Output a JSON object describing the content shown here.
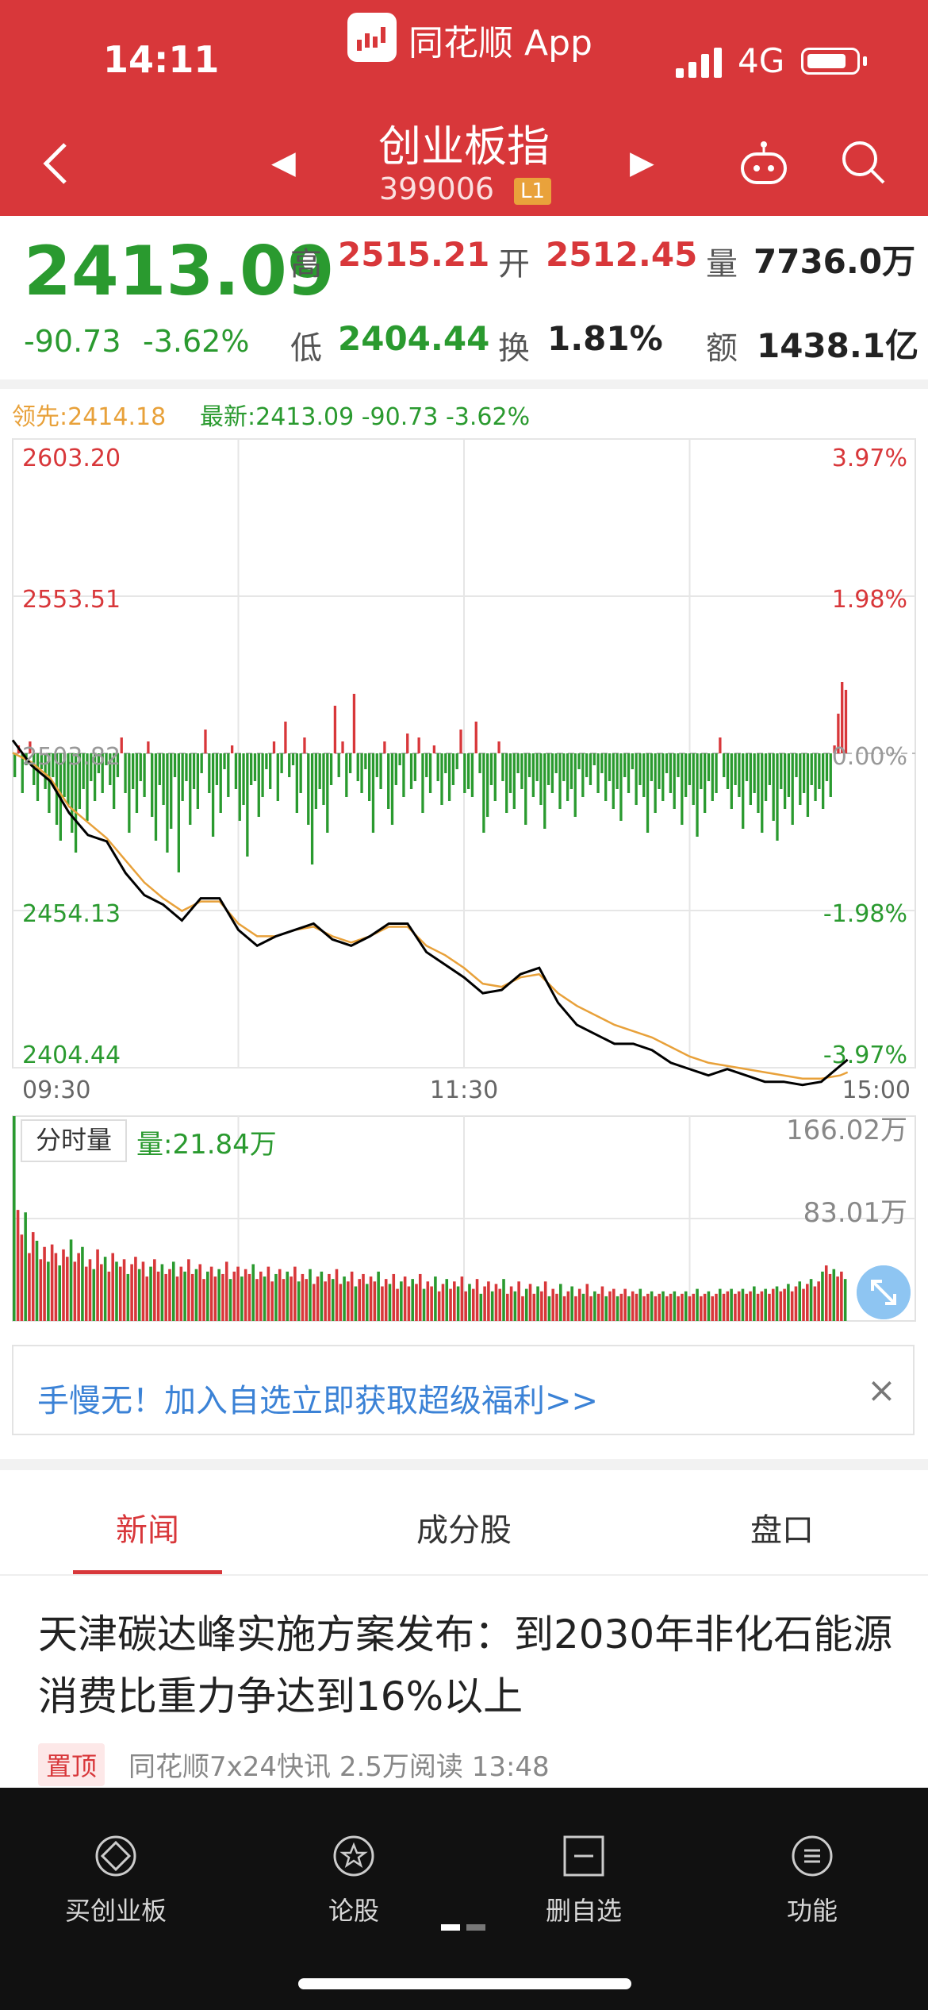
{
  "status_bar": {
    "time": "14:11",
    "app": "同花顺 App",
    "network": "4G"
  },
  "header": {
    "name": "创业板指",
    "code": "399006",
    "level": "L1"
  },
  "quote": {
    "last": "2413.09",
    "change": "-90.73",
    "change_pct": "-3.62%",
    "high_label": "高",
    "high": "2515.21",
    "open_label": "开",
    "open": "2512.45",
    "vol_label": "量",
    "volume": "7736.0万",
    "low_label": "低",
    "low": "2404.44",
    "turnover_label": "换",
    "turnover": "1.81%",
    "amount_label": "额",
    "amount": "1438.1亿"
  },
  "legend": {
    "lead": "领先:2414.18",
    "latest": "最新:2413.09  -90.73  -3.62%"
  },
  "volume_panel": {
    "tab": "分时量",
    "current": "量:21.84万",
    "max": "166.02万",
    "mid": "83.01万"
  },
  "promo": {
    "text": "手慢无！加入自选立即获取超级福利>>",
    "close": "×"
  },
  "tabs": [
    "新闻",
    "成分股",
    "盘口"
  ],
  "news": {
    "title": "天津碳达峰实施方案发布：到2030年非化石能源消费比重力争达到16%以上",
    "pin": "置顶",
    "meta": "同花顺7x24快讯  2.5万阅读  13:48"
  },
  "bottom_bar": [
    "买创业板",
    "论股",
    "删自选",
    "功能"
  ],
  "colors": {
    "up": "#d8373a",
    "down": "#2a9a2f",
    "lead_line": "#e8a13a",
    "price_line": "#000000",
    "header": "#d8373a"
  },
  "chart_data": {
    "type": "line",
    "title": "",
    "xlabel": "",
    "ylabel": "",
    "x_ticks": [
      "09:30",
      "11:30",
      "15:00"
    ],
    "y_ticks": [
      "2603.20",
      "2553.51",
      "2503.82",
      "2454.13",
      "2404.44"
    ],
    "y_pct_ticks": [
      "3.97%",
      "1.98%",
      "0.00%",
      "-1.98%",
      "-3.97%"
    ],
    "ylim": [
      2404.44,
      2603.2
    ],
    "prev_close": 2503.82,
    "x_minutes": [
      0,
      5,
      10,
      15,
      20,
      25,
      30,
      35,
      40,
      45,
      50,
      55,
      60,
      65,
      70,
      75,
      80,
      85,
      90,
      95,
      100,
      105,
      110,
      115,
      120,
      125,
      130,
      135,
      140,
      145,
      150,
      155,
      160,
      165,
      170,
      175,
      180,
      185,
      190,
      195,
      200,
      205,
      210,
      215,
      220,
      222
    ],
    "series": [
      {
        "name": "最新",
        "values": [
          2508,
          2500,
          2495,
          2485,
          2478,
          2476,
          2466,
          2459,
          2456,
          2451,
          2458,
          2458,
          2448,
          2443,
          2446,
          2448,
          2450,
          2445,
          2443,
          2446,
          2450,
          2450,
          2441,
          2437,
          2433,
          2428,
          2429,
          2434,
          2436,
          2425,
          2418,
          2415,
          2412,
          2412,
          2410,
          2406,
          2404,
          2402,
          2404,
          2402,
          2400,
          2400,
          2399,
          2400,
          2405,
          2407
        ]
      },
      {
        "name": "领先",
        "values": [
          2504,
          2501,
          2496,
          2487,
          2482,
          2477,
          2470,
          2463,
          2458,
          2454,
          2457,
          2457,
          2450,
          2446,
          2446,
          2448,
          2449,
          2446,
          2444,
          2446,
          2449,
          2449,
          2443,
          2440,
          2436,
          2431,
          2430,
          2433,
          2434,
          2428,
          2424,
          2421,
          2418,
          2416,
          2414,
          2411,
          2408,
          2406,
          2405,
          2404,
          2403,
          2402,
          2401,
          2401,
          2402,
          2403
        ]
      }
    ],
    "bars": [
      -6,
      2,
      -10,
      -3,
      3,
      -8,
      -12,
      -4,
      -9,
      -15,
      -6,
      -18,
      -22,
      -11,
      -13,
      -20,
      -25,
      -14,
      -9,
      -17,
      -7,
      -12,
      -5,
      -10,
      -3,
      -8,
      -14,
      -6,
      4,
      -10,
      -20,
      -9,
      -15,
      -7,
      -11,
      3,
      -16,
      -22,
      -8,
      -13,
      -25,
      -19,
      -6,
      -30,
      -12,
      -7,
      -18,
      -9,
      -14,
      -5,
      6,
      -10,
      -21,
      -8,
      -15,
      -4,
      -11,
      2,
      -9,
      -17,
      -13,
      -26,
      -8,
      -7,
      -16,
      -11,
      -4,
      -9,
      3,
      -12,
      -5,
      8,
      -6,
      -3,
      -15,
      -10,
      4,
      -18,
      -28,
      -14,
      -9,
      -13,
      -20,
      -8,
      12,
      -6,
      3,
      -11,
      -5,
      15,
      -7,
      -10,
      -4,
      -12,
      -20,
      -6,
      -9,
      3,
      -14,
      -18,
      -8,
      -3,
      -11,
      5,
      -9,
      -7,
      4,
      -15,
      -6,
      -10,
      2,
      -7,
      -13,
      -5,
      -12,
      -8,
      -4,
      6,
      -10,
      -9,
      -11,
      8,
      -5,
      -20,
      -16,
      -8,
      -12,
      3,
      -7,
      -15,
      -10,
      -14,
      -5,
      -9,
      -18,
      -6,
      -11,
      -7,
      -13,
      -19,
      -8,
      -10,
      -5,
      -14,
      -7,
      -12,
      -9,
      -16,
      -4,
      -11,
      -6,
      -8,
      -3,
      -10,
      -5,
      -12,
      -7,
      -14,
      -9,
      -17,
      -6,
      -10,
      -4,
      -13,
      -8,
      -11,
      -20,
      -7,
      -15,
      -9,
      -12,
      -5,
      -10,
      -14,
      -6,
      -18,
      -11,
      -8,
      -13,
      -21,
      -9,
      -15,
      -7,
      -12,
      -10,
      4,
      -6,
      -9,
      -14,
      -8,
      -11,
      -19,
      -7,
      -13,
      -10,
      -15,
      -20,
      -12,
      -8,
      -17,
      -22,
      -9,
      -14,
      -11,
      -18,
      -6,
      -13,
      -10,
      -16,
      -8,
      -12,
      -9,
      -14,
      -7,
      -11,
      2,
      10,
      18,
      16
    ],
    "volume": [
      166,
      90,
      70,
      88,
      55,
      72,
      65,
      50,
      60,
      48,
      62,
      55,
      45,
      58,
      52,
      66,
      48,
      55,
      60,
      44,
      50,
      42,
      58,
      46,
      52,
      40,
      55,
      48,
      44,
      50,
      38,
      46,
      52,
      42,
      48,
      36,
      44,
      50,
      40,
      46,
      38,
      42,
      48,
      36,
      44,
      40,
      50,
      38,
      42,
      46,
      34,
      40,
      44,
      36,
      42,
      38,
      48,
      34,
      40,
      44,
      36,
      42,
      38,
      46,
      34,
      40,
      36,
      44,
      32,
      38,
      42,
      34,
      40,
      36,
      44,
      32,
      38,
      34,
      42,
      30,
      36,
      40,
      32,
      38,
      34,
      42,
      30,
      36,
      32,
      40,
      28,
      34,
      38,
      30,
      36,
      32,
      40,
      28,
      34,
      30,
      38,
      26,
      32,
      36,
      28,
      34,
      30,
      38,
      26,
      32,
      28,
      36,
      24,
      30,
      34,
      26,
      32,
      28,
      36,
      24,
      30,
      26,
      34,
      22,
      28,
      32,
      24,
      30,
      26,
      34,
      22,
      28,
      24,
      32,
      20,
      26,
      30,
      22,
      28,
      24,
      32,
      20,
      26,
      22,
      30,
      20,
      24,
      28,
      20,
      26,
      22,
      30,
      20,
      24,
      22,
      28,
      20,
      24,
      26,
      20,
      22,
      26,
      20,
      24,
      22,
      26,
      20,
      22,
      24,
      20,
      22,
      24,
      20,
      22,
      24,
      20,
      22,
      24,
      20,
      22,
      26,
      20,
      22,
      24,
      20,
      22,
      26,
      22,
      24,
      26,
      22,
      24,
      26,
      22,
      24,
      28,
      22,
      24,
      26,
      22,
      26,
      28,
      24,
      26,
      30,
      24,
      28,
      32,
      26,
      30,
      34,
      28,
      32,
      40,
      45,
      38,
      42,
      36,
      40,
      34
    ]
  }
}
